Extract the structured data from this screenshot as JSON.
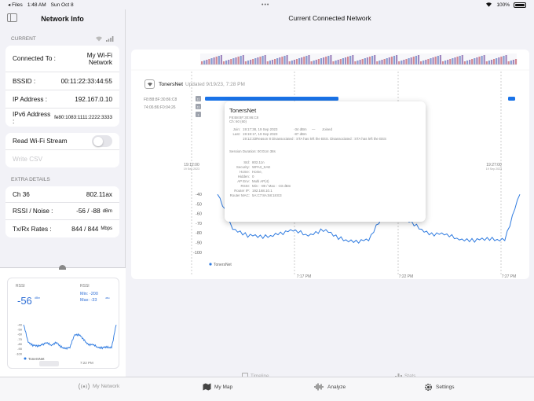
{
  "status": {
    "app": "Files",
    "time": "1:48 AM",
    "date": "Sun Oct 8",
    "battery": "100%"
  },
  "sidebar": {
    "title": "Network Info",
    "current_label": "CURRENT",
    "connected_to_label": "Connected To :",
    "connected_to_value": "My Wi-Fi Network",
    "bssid_label": "BSSID :",
    "bssid_value": "00:11:22:33:44:55",
    "ip_label": "IP Address :",
    "ip_value": "192.167.0.10",
    "ipv6_label": "IPv6 Address :",
    "ipv6_value": "fe80:1083:1111:2222:3333",
    "read_stream_label": "Read Wi-Fi Stream",
    "write_csv_label": "Write CSV",
    "extra_label": "EXTRA DETAILS",
    "channel_label": "Ch 36",
    "channel_value": "802.11ax",
    "rssi_noise_label": "RSSI / Noise :",
    "rssi_noise_value": "-56 / -88",
    "rssi_noise_unit": "dBm",
    "txrx_label": "Tx/Rx Rates :",
    "txrx_value": "844 / 844",
    "txrx_unit": "Mbps"
  },
  "mini_chart": {
    "rssi_label": "RSSI",
    "rssi_value": "-56",
    "rssi_unit": "dBm",
    "rssi2_label": "RSSI",
    "min_text": "Min: -200",
    "max_text": "Max: -33",
    "max_unit": "dBm",
    "y_ticks": [
      "-40",
      "-50",
      "-60",
      "-70",
      "-80",
      "-90",
      "-100"
    ],
    "legend": "TonersNet",
    "x_tick": "7:22 PM"
  },
  "main": {
    "title": "Current Connected Network",
    "network_name": "TonersNet",
    "updated": "Updated 9/19/23, 7:28 PM",
    "bssid_rows": [
      "F8:B8:8F:30:86:C8",
      "74:06:86:F0:04:26"
    ],
    "bssid_tags": [
      "11",
      "11",
      "1"
    ],
    "timeline_left": "19:12:00",
    "timeline_left_date": "19 Sep 2023",
    "timeline_right": "19:27:00",
    "timeline_right_date": "19 Sep 2023",
    "y_ticks": [
      "-40",
      "-50",
      "-60",
      "-70",
      "-80",
      "-90",
      "-100"
    ],
    "x_ticks": [
      "7:17 PM",
      "7:22 PM",
      "7:27 PM"
    ],
    "legend": "TonersNet"
  },
  "tooltip": {
    "name": "TonersNet",
    "mac": "F8:B8:8F:30:86:C8",
    "channel": "Ch: 60 (60)",
    "join_label": "Join:",
    "join_value": "19:17:38, 19 Sep 2023",
    "join_signal": "-34 dBm",
    "join_arrow": "—",
    "join_event": "Joined",
    "last_label": "Last:",
    "last_value": "19:19:17, 19 Sep 2023",
    "last_signal": "-87 dBm",
    "reason": "19:12:33Reason 8 Disassociated : STA has left the BSS. Disassociated : STA has left the BSS",
    "session": "Session Duration: 00:01m 38s",
    "fields": [
      {
        "label": "Std:",
        "value": "802.11n"
      },
      {
        "label": "Security:",
        "value": "WPA3_SAE"
      },
      {
        "label": "Home:",
        "value": "Home,"
      },
      {
        "label": "Hidden:",
        "value": "0"
      },
      {
        "label": "AP Env:",
        "value": "Multi AP(4)"
      },
      {
        "label": "RSSI:",
        "value": "Min : -89 / Max : -33 dBm"
      },
      {
        "label": "Router IP:",
        "value": "192.168.10.1"
      },
      {
        "label": "Router MAC:",
        "value": "5A:C7:8A:58:18:E3"
      }
    ]
  },
  "subtabs": {
    "timeline": "Timeline",
    "stats": "Stats"
  },
  "tabs": {
    "my_network": "My Network",
    "my_map": "My Map",
    "analyze": "Analyze",
    "settings": "Settings"
  },
  "chart_data": {
    "type": "line",
    "title": "",
    "xlabel": "",
    "ylabel": "",
    "ylim": [
      -100,
      -35
    ],
    "x_ticks": [
      "7:17 PM",
      "7:22 PM",
      "7:27 PM"
    ],
    "series": [
      {
        "name": "TonersNet",
        "x": [
          0,
          1,
          2,
          3,
          4,
          5,
          6,
          7,
          8,
          9,
          10,
          11,
          12,
          13,
          14,
          15,
          16,
          17,
          18,
          19,
          20
        ],
        "values": [
          -40,
          -75,
          -82,
          -85,
          -80,
          -78,
          -82,
          -76,
          -86,
          -88,
          -88,
          -60,
          -60,
          -72,
          -80,
          -82,
          -86,
          -87,
          -87,
          -86,
          -40
        ]
      }
    ]
  },
  "colors": {
    "accent": "#1a73e8",
    "line": "#2f7be0",
    "tab_active": "#444444"
  }
}
